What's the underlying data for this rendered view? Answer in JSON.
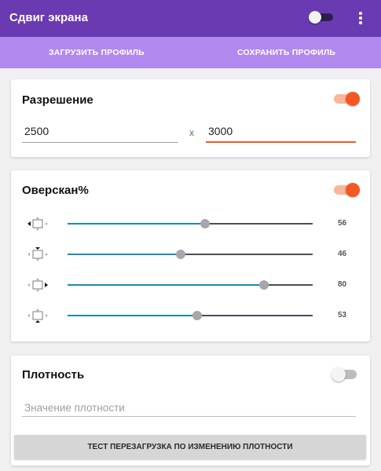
{
  "appbar": {
    "title": "Сдвиг экрана",
    "master_switch_on": false,
    "menu_icon": "more-vert-icon"
  },
  "toolbar": {
    "load_label": "ЗАГРУЗИТЬ ПРОФИЛЬ",
    "save_label": "СОХРАНИТЬ ПРОФИЛЬ"
  },
  "resolution": {
    "title": "Разрешение",
    "enabled": true,
    "width": "2500",
    "separator": "x",
    "height": "3000"
  },
  "overscan": {
    "title": "Оверскан%",
    "enabled": true,
    "max": 100,
    "sliders": [
      {
        "side": "left",
        "icon": "overscan-left-icon",
        "value": 56,
        "label": "56"
      },
      {
        "side": "top",
        "icon": "overscan-top-icon",
        "value": 46,
        "label": "46"
      },
      {
        "side": "right",
        "icon": "overscan-right-icon",
        "value": 80,
        "label": "80"
      },
      {
        "side": "bottom",
        "icon": "overscan-bottom-icon",
        "value": 53,
        "label": "53"
      }
    ]
  },
  "density": {
    "title": "Плотность",
    "enabled": false,
    "placeholder": "Значение плотности",
    "test_button_label": "ТЕСТ ПЕРЕЗАГРУЗКА ПО ИЗМЕНЕНИЮ ПЛОТНОСТИ"
  },
  "colors": {
    "appbar": "#6a3ab2",
    "toolbar": "#b189ee",
    "accent": "#f45722",
    "slider_fill": "#1b8ab2"
  }
}
